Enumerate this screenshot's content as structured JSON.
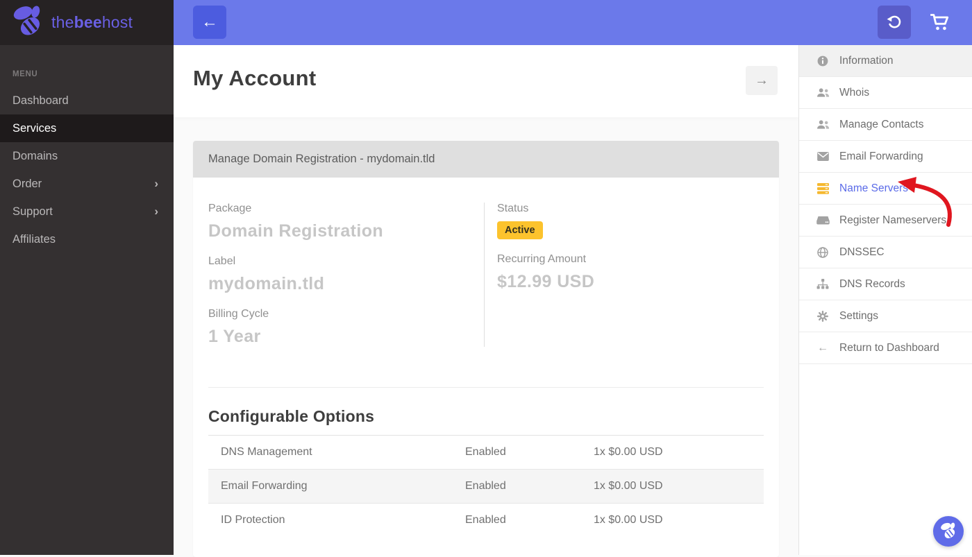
{
  "colors": {
    "topbar": "#6b79ea",
    "brand_purple": "#675ce2",
    "badge_yellow": "#fcc32d",
    "link_blue": "#5b6be8",
    "annotation_red": "#e0161f",
    "sidebar_dark": "#343031"
  },
  "brand": {
    "pre": "the",
    "bold": "bee",
    "post": "host"
  },
  "icons": {
    "back": "←",
    "forward": "→",
    "chevron": "›",
    "return_arrow": "←"
  },
  "left_sidebar": {
    "menu_label": "MENU",
    "items": [
      {
        "label": "Dashboard"
      },
      {
        "label": "Services"
      },
      {
        "label": "Domains"
      },
      {
        "label": "Order"
      },
      {
        "label": "Support"
      },
      {
        "label": "Affiliates"
      }
    ]
  },
  "page": {
    "title": "My Account"
  },
  "card": {
    "header": "Manage Domain Registration - mydomain.tld",
    "details": {
      "package_label": "Package",
      "package_value": "Domain Registration",
      "label_label": "Label",
      "label_value": "mydomain.tld",
      "billing_label": "Billing Cycle",
      "billing_value": "1 Year",
      "status_label": "Status",
      "status_value": "Active",
      "recurring_label": "Recurring Amount",
      "recurring_value": "$12.99 USD"
    },
    "options": {
      "title": "Configurable Options",
      "rows": [
        {
          "name": "DNS Management",
          "status": "Enabled",
          "price": "1x $0.00 USD"
        },
        {
          "name": "Email Forwarding",
          "status": "Enabled",
          "price": "1x $0.00 USD"
        },
        {
          "name": "ID Protection",
          "status": "Enabled",
          "price": "1x $0.00 USD"
        }
      ]
    }
  },
  "right_sidebar": {
    "items": [
      {
        "label": "Information"
      },
      {
        "label": "Whois"
      },
      {
        "label": "Manage Contacts"
      },
      {
        "label": "Email Forwarding"
      },
      {
        "label": "Name Servers"
      },
      {
        "label": "Register Nameservers"
      },
      {
        "label": "DNSSEC"
      },
      {
        "label": "DNS Records"
      },
      {
        "label": "Settings"
      },
      {
        "label": "Return to Dashboard"
      }
    ]
  }
}
